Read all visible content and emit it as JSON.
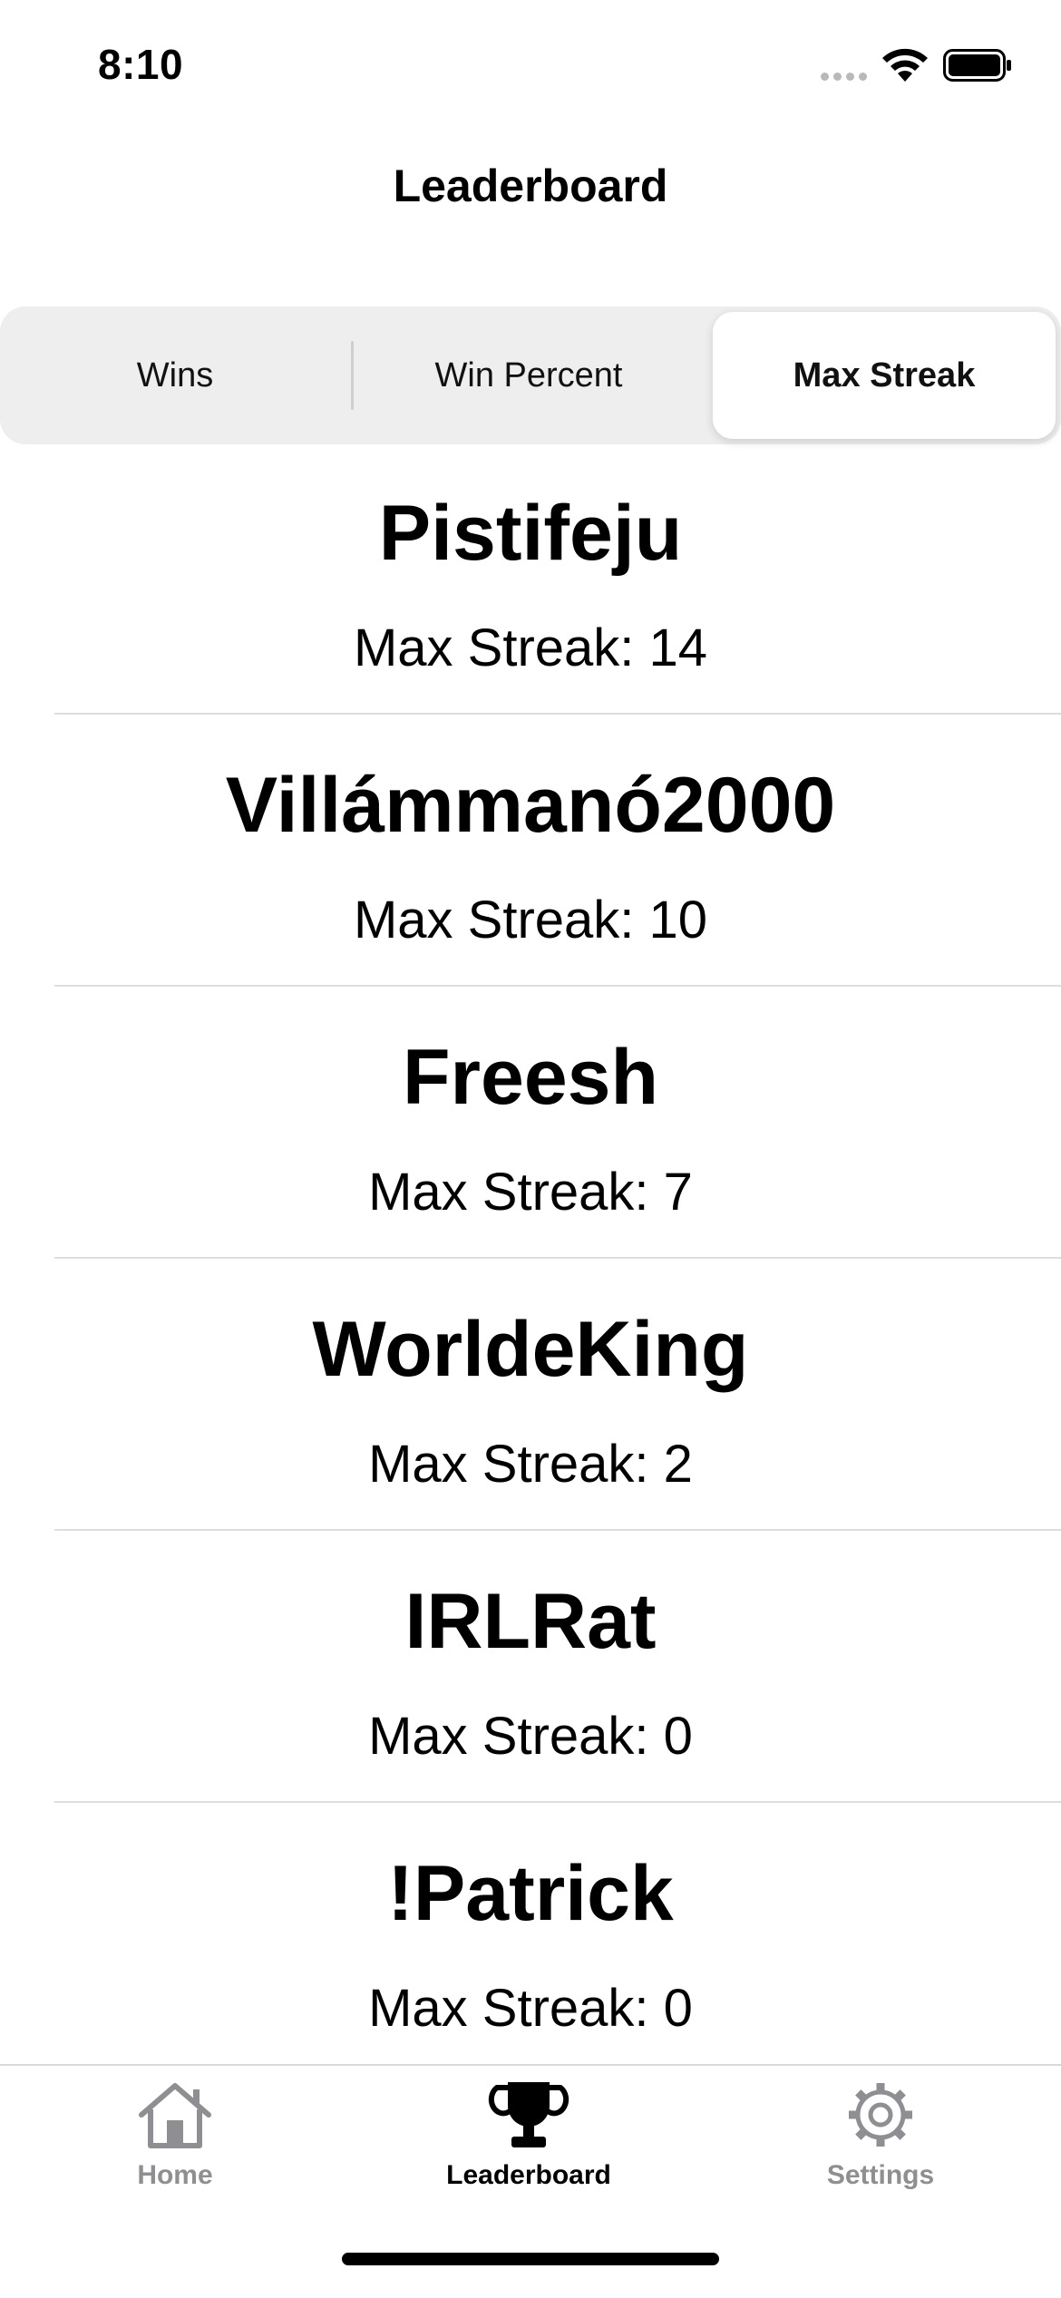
{
  "status_bar": {
    "time": "8:10"
  },
  "nav": {
    "title": "Leaderboard"
  },
  "segmented": {
    "options": [
      "Wins",
      "Win Percent",
      "Max Streak"
    ],
    "selected": "Max Streak"
  },
  "leaderboard": [
    {
      "name": "Pistifeju",
      "stat": "Max Streak: 14"
    },
    {
      "name": "Villámmanó2000",
      "stat": "Max Streak: 10"
    },
    {
      "name": "Freesh",
      "stat": "Max Streak: 7"
    },
    {
      "name": "WorldeKing",
      "stat": "Max Streak: 2"
    },
    {
      "name": "IRLRat",
      "stat": "Max Streak: 0"
    },
    {
      "name": "!Patrick",
      "stat": "Max Streak: 0"
    }
  ],
  "tab_bar": {
    "items": [
      {
        "label": "Home",
        "icon": "house-icon"
      },
      {
        "label": "Leaderboard",
        "icon": "trophy-icon"
      },
      {
        "label": "Settings",
        "icon": "gear-icon"
      }
    ],
    "selected": "Leaderboard"
  }
}
